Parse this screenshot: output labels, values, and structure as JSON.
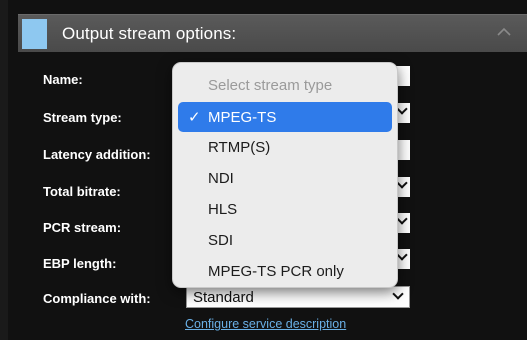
{
  "header": {
    "title": "Output stream options:"
  },
  "labels": {
    "name": "Name:",
    "stream_type": "Stream type:",
    "latency_addition": "Latency addition:",
    "total_bitrate": "Total bitrate:",
    "pcr_stream": "PCR stream:",
    "ebp_length": "EBP length:",
    "compliance_with": "Compliance with:"
  },
  "compliance": {
    "value": "Standard"
  },
  "link": {
    "text": "Configure service description"
  },
  "dropdown": {
    "placeholder": "Select stream type",
    "check": "✓",
    "options": [
      "MPEG-TS",
      "RTMP(S)",
      "NDI",
      "HLS",
      "SDI",
      "MPEG-TS PCR only"
    ],
    "selected": "MPEG-TS"
  },
  "colors": {
    "accent": "#8ec8f0",
    "selection": "#2f7bea",
    "link": "#6ab0e6"
  }
}
